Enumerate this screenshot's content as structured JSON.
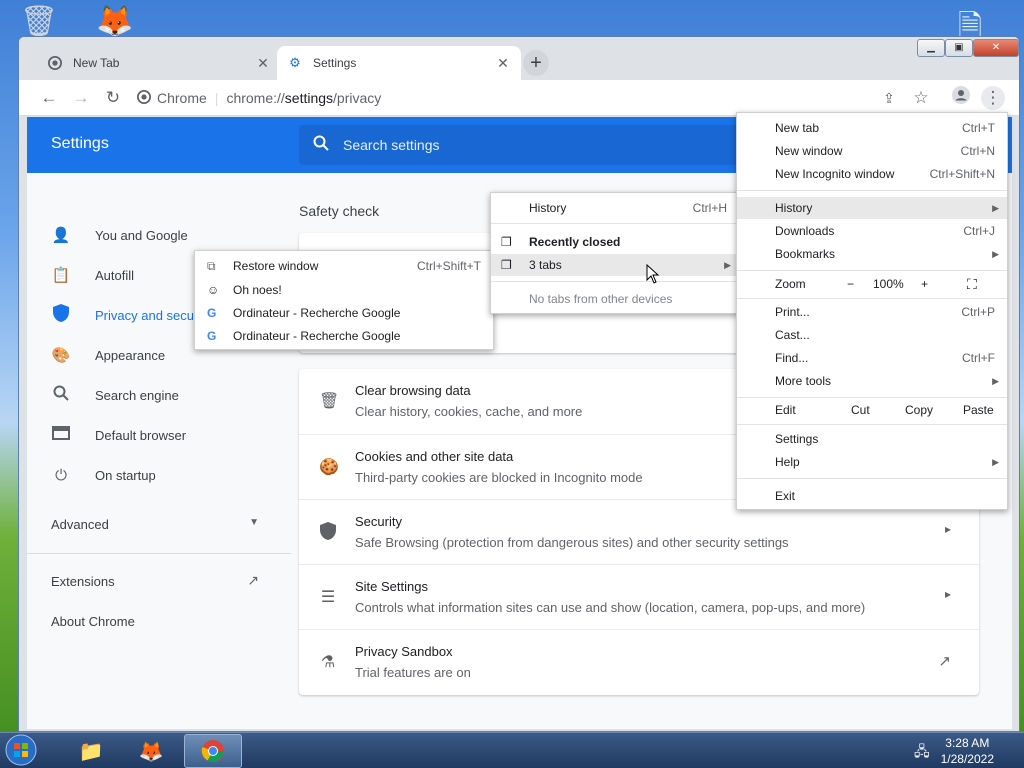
{
  "browser": {
    "tabs": [
      {
        "label": "New Tab",
        "icon": "chrome-icon"
      },
      {
        "label": "Settings",
        "icon": "gear-icon"
      }
    ],
    "omnibox": {
      "site": "Chrome",
      "url_host": "chrome://",
      "url_path": "settings",
      "url_rest": "/privacy"
    }
  },
  "settings": {
    "title": "Settings",
    "search_placeholder": "Search settings",
    "nav": [
      {
        "label": "You and Google",
        "icon": "person-icon"
      },
      {
        "label": "Autofill",
        "icon": "clipboard-icon"
      },
      {
        "label": "Privacy and security",
        "icon": "shield-icon"
      },
      {
        "label": "Appearance",
        "icon": "palette-icon"
      },
      {
        "label": "Search engine",
        "icon": "search-icon"
      },
      {
        "label": "Default browser",
        "icon": "browser-icon"
      },
      {
        "label": "On startup",
        "icon": "power-icon"
      }
    ],
    "advanced": "Advanced",
    "extensions": "Extensions",
    "about": "About Chrome",
    "safety_check": "Safety check",
    "rows": [
      {
        "title": "Clear browsing data",
        "sub": "Clear history, cookies, cache, and more",
        "icon": "trash-icon"
      },
      {
        "title": "Cookies and other site data",
        "sub": "Third-party cookies are blocked in Incognito mode",
        "icon": "cookie-icon"
      },
      {
        "title": "Security",
        "sub": "Safe Browsing (protection from dangerous sites) and other security settings",
        "icon": "shield-icon"
      },
      {
        "title": "Site Settings",
        "sub": "Controls what information sites can use and show (location, camera, pop-ups, and more)",
        "icon": "sliders-icon"
      },
      {
        "title": "Privacy Sandbox",
        "sub": "Trial features are on",
        "icon": "flask-icon"
      }
    ]
  },
  "main_menu": {
    "new_tab": {
      "label": "New tab",
      "shortcut": "Ctrl+T"
    },
    "new_window": {
      "label": "New window",
      "shortcut": "Ctrl+N"
    },
    "new_incognito": {
      "label": "New Incognito window",
      "shortcut": "Ctrl+Shift+N"
    },
    "history": {
      "label": "History"
    },
    "downloads": {
      "label": "Downloads",
      "shortcut": "Ctrl+J"
    },
    "bookmarks": {
      "label": "Bookmarks"
    },
    "zoom": {
      "label": "Zoom",
      "minus": "−",
      "value": "100%",
      "plus": "+"
    },
    "print": {
      "label": "Print...",
      "shortcut": "Ctrl+P"
    },
    "cast": {
      "label": "Cast..."
    },
    "find": {
      "label": "Find...",
      "shortcut": "Ctrl+F"
    },
    "more_tools": {
      "label": "More tools"
    },
    "edit": {
      "label": "Edit",
      "cut": "Cut",
      "copy": "Copy",
      "paste": "Paste"
    },
    "settings": {
      "label": "Settings"
    },
    "help": {
      "label": "Help"
    },
    "exit": {
      "label": "Exit"
    }
  },
  "history_menu": {
    "history": {
      "label": "History",
      "shortcut": "Ctrl+H"
    },
    "recently_closed": "Recently closed",
    "tabs_group": "3 tabs",
    "no_other_devices": "No tabs from other devices"
  },
  "tabs_menu": {
    "restore": {
      "label": "Restore window",
      "shortcut": "Ctrl+Shift+T"
    },
    "items": [
      "Oh noes!",
      "Ordinateur - Recherche Google",
      "Ordinateur - Recherche Google"
    ]
  },
  "taskbar": {
    "time": "3:28 AM",
    "date": "1/28/2022"
  },
  "colors": {
    "accent": "#1a73e8",
    "header": "#1a73e8",
    "search": "#1967d2"
  }
}
